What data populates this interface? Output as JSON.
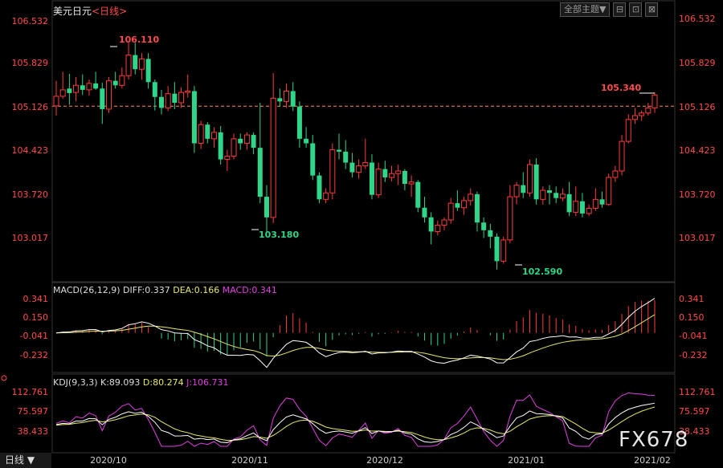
{
  "header": {
    "title": "美元日元",
    "interval": "<日线>",
    "theme_button": "全部主题▼",
    "btn_minimize": "⊟",
    "btn_restore": "⊡",
    "btn_close": "⊠"
  },
  "price_axis": {
    "ticks": [
      "106.532",
      "105.829",
      "105.126",
      "104.423",
      "103.720",
      "103.017"
    ],
    "ref_line": 105.126
  },
  "annotations": {
    "high_label": "106.110",
    "low1_label": "103.180",
    "low2_label": "102.590",
    "last_label": "105.340"
  },
  "macd": {
    "title": "MACD(26,12,9)",
    "diff": "DIFF:0.337",
    "dea": "DEA:0.166",
    "macd": "MACD:0.341",
    "ticks": [
      "0.341",
      "0.150",
      "-0.041",
      "-0.232"
    ]
  },
  "kdj": {
    "title": "KDJ(9,3,3)",
    "k": "K:89.093",
    "d": "D:80.274",
    "j": "J:106.731",
    "ticks": [
      "112.761",
      "75.597",
      "38.433"
    ]
  },
  "x_axis": {
    "labels": [
      "2020/10",
      "2020/11",
      "2020/12",
      "2021/01",
      "2021/02"
    ]
  },
  "footer": {
    "period": "日线",
    "watermark": "FX678"
  },
  "colors": {
    "up": "#ff3b3b",
    "down": "#2fd68a",
    "diff": "#ffffff",
    "dea": "#e8e86a",
    "macd": "#e040e0",
    "ref": "#ff8a5a",
    "axis_text": "#ff4b4b"
  },
  "chart_data": {
    "type": "candlestick",
    "price_range": [
      102.5,
      106.65
    ],
    "candles": [
      {
        "o": 105.13,
        "h": 105.52,
        "l": 104.98,
        "c": 105.28
      },
      {
        "o": 105.28,
        "h": 105.66,
        "l": 105.24,
        "c": 105.38
      },
      {
        "o": 105.4,
        "h": 105.63,
        "l": 105.15,
        "c": 105.33
      },
      {
        "o": 105.34,
        "h": 105.58,
        "l": 105.2,
        "c": 105.45
      },
      {
        "o": 105.45,
        "h": 105.62,
        "l": 105.3,
        "c": 105.38
      },
      {
        "o": 105.38,
        "h": 105.54,
        "l": 105.29,
        "c": 105.48
      },
      {
        "o": 105.48,
        "h": 105.66,
        "l": 105.38,
        "c": 105.4
      },
      {
        "o": 105.4,
        "h": 105.49,
        "l": 104.85,
        "c": 105.08
      },
      {
        "o": 105.08,
        "h": 105.58,
        "l": 105.02,
        "c": 105.52
      },
      {
        "o": 105.52,
        "h": 105.66,
        "l": 105.4,
        "c": 105.45
      },
      {
        "o": 105.45,
        "h": 105.73,
        "l": 105.4,
        "c": 105.6
      },
      {
        "o": 105.6,
        "h": 106.11,
        "l": 105.54,
        "c": 105.92
      },
      {
        "o": 105.92,
        "h": 106.11,
        "l": 105.62,
        "c": 105.7
      },
      {
        "o": 105.7,
        "h": 105.95,
        "l": 105.54,
        "c": 105.86
      },
      {
        "o": 105.86,
        "h": 105.95,
        "l": 105.4,
        "c": 105.5
      },
      {
        "o": 105.5,
        "h": 105.54,
        "l": 105.06,
        "c": 105.27
      },
      {
        "o": 105.27,
        "h": 105.38,
        "l": 105.0,
        "c": 105.1
      },
      {
        "o": 105.1,
        "h": 105.44,
        "l": 105.05,
        "c": 105.32
      },
      {
        "o": 105.32,
        "h": 105.5,
        "l": 105.08,
        "c": 105.18
      },
      {
        "o": 105.18,
        "h": 105.42,
        "l": 105.1,
        "c": 105.34
      },
      {
        "o": 105.34,
        "h": 105.62,
        "l": 105.26,
        "c": 105.36
      },
      {
        "o": 105.36,
        "h": 105.44,
        "l": 104.4,
        "c": 104.55
      },
      {
        "o": 104.55,
        "h": 104.9,
        "l": 104.46,
        "c": 104.84
      },
      {
        "o": 104.84,
        "h": 104.88,
        "l": 104.55,
        "c": 104.62
      },
      {
        "o": 104.62,
        "h": 104.8,
        "l": 104.48,
        "c": 104.72
      },
      {
        "o": 104.72,
        "h": 104.82,
        "l": 104.22,
        "c": 104.3
      },
      {
        "o": 104.3,
        "h": 104.45,
        "l": 104.12,
        "c": 104.35
      },
      {
        "o": 104.35,
        "h": 104.7,
        "l": 104.3,
        "c": 104.62
      },
      {
        "o": 104.62,
        "h": 104.7,
        "l": 104.45,
        "c": 104.55
      },
      {
        "o": 104.55,
        "h": 104.72,
        "l": 104.45,
        "c": 104.68
      },
      {
        "o": 104.68,
        "h": 104.72,
        "l": 104.38,
        "c": 104.48
      },
      {
        "o": 104.48,
        "h": 105.18,
        "l": 103.62,
        "c": 103.72
      },
      {
        "o": 103.72,
        "h": 103.9,
        "l": 103.18,
        "c": 103.4
      },
      {
        "o": 103.4,
        "h": 105.64,
        "l": 103.31,
        "c": 105.25
      },
      {
        "o": 105.25,
        "h": 105.4,
        "l": 105.12,
        "c": 105.2
      },
      {
        "o": 105.2,
        "h": 105.48,
        "l": 105.1,
        "c": 105.36
      },
      {
        "o": 105.36,
        "h": 105.5,
        "l": 105.05,
        "c": 105.12
      },
      {
        "o": 105.12,
        "h": 105.2,
        "l": 104.48,
        "c": 104.62
      },
      {
        "o": 104.62,
        "h": 104.8,
        "l": 104.48,
        "c": 104.55
      },
      {
        "o": 104.55,
        "h": 104.68,
        "l": 103.98,
        "c": 104.05
      },
      {
        "o": 104.05,
        "h": 104.1,
        "l": 103.62,
        "c": 103.68
      },
      {
        "o": 103.68,
        "h": 103.85,
        "l": 103.62,
        "c": 103.78
      },
      {
        "o": 103.78,
        "h": 104.55,
        "l": 103.68,
        "c": 104.45
      },
      {
        "o": 104.45,
        "h": 104.7,
        "l": 104.3,
        "c": 104.42
      },
      {
        "o": 104.42,
        "h": 104.6,
        "l": 104.15,
        "c": 104.25
      },
      {
        "o": 104.25,
        "h": 104.4,
        "l": 104.02,
        "c": 104.1
      },
      {
        "o": 104.1,
        "h": 104.3,
        "l": 104.0,
        "c": 104.2
      },
      {
        "o": 104.2,
        "h": 104.62,
        "l": 104.15,
        "c": 104.25
      },
      {
        "o": 104.25,
        "h": 104.38,
        "l": 103.68,
        "c": 103.75
      },
      {
        "o": 103.75,
        "h": 104.25,
        "l": 103.7,
        "c": 104.15
      },
      {
        "o": 104.15,
        "h": 104.28,
        "l": 103.95,
        "c": 104.02
      },
      {
        "o": 104.02,
        "h": 104.2,
        "l": 103.96,
        "c": 104.08
      },
      {
        "o": 104.08,
        "h": 104.22,
        "l": 103.9,
        "c": 104.12
      },
      {
        "o": 104.12,
        "h": 104.15,
        "l": 103.82,
        "c": 103.92
      },
      {
        "o": 103.92,
        "h": 104.05,
        "l": 103.72,
        "c": 103.95
      },
      {
        "o": 103.95,
        "h": 103.98,
        "l": 103.48,
        "c": 103.55
      },
      {
        "o": 103.55,
        "h": 103.72,
        "l": 103.32,
        "c": 103.4
      },
      {
        "o": 103.4,
        "h": 103.48,
        "l": 102.98,
        "c": 103.18
      },
      {
        "o": 103.18,
        "h": 103.35,
        "l": 103.12,
        "c": 103.28
      },
      {
        "o": 103.28,
        "h": 103.4,
        "l": 103.2,
        "c": 103.36
      },
      {
        "o": 103.36,
        "h": 103.7,
        "l": 103.3,
        "c": 103.62
      },
      {
        "o": 103.62,
        "h": 103.82,
        "l": 103.5,
        "c": 103.55
      },
      {
        "o": 103.55,
        "h": 103.72,
        "l": 103.44,
        "c": 103.66
      },
      {
        "o": 103.66,
        "h": 103.85,
        "l": 103.58,
        "c": 103.76
      },
      {
        "o": 103.76,
        "h": 103.8,
        "l": 103.18,
        "c": 103.32
      },
      {
        "o": 103.32,
        "h": 103.4,
        "l": 103.08,
        "c": 103.2
      },
      {
        "o": 103.2,
        "h": 103.3,
        "l": 102.92,
        "c": 103.1
      },
      {
        "o": 103.1,
        "h": 103.15,
        "l": 102.59,
        "c": 102.72
      },
      {
        "o": 102.72,
        "h": 103.1,
        "l": 102.68,
        "c": 103.05
      },
      {
        "o": 103.05,
        "h": 103.9,
        "l": 103.0,
        "c": 103.72
      },
      {
        "o": 103.72,
        "h": 103.95,
        "l": 103.6,
        "c": 103.9
      },
      {
        "o": 103.9,
        "h": 104.1,
        "l": 103.7,
        "c": 103.78
      },
      {
        "o": 103.78,
        "h": 104.3,
        "l": 103.72,
        "c": 104.22
      },
      {
        "o": 104.22,
        "h": 104.32,
        "l": 103.6,
        "c": 103.68
      },
      {
        "o": 103.68,
        "h": 103.88,
        "l": 103.6,
        "c": 103.82
      },
      {
        "o": 103.82,
        "h": 103.9,
        "l": 103.6,
        "c": 103.78
      },
      {
        "o": 103.78,
        "h": 103.88,
        "l": 103.62,
        "c": 103.7
      },
      {
        "o": 103.7,
        "h": 103.85,
        "l": 103.65,
        "c": 103.76
      },
      {
        "o": 103.76,
        "h": 103.95,
        "l": 103.42,
        "c": 103.48
      },
      {
        "o": 103.48,
        "h": 103.88,
        "l": 103.42,
        "c": 103.65
      },
      {
        "o": 103.65,
        "h": 103.78,
        "l": 103.4,
        "c": 103.46
      },
      {
        "o": 103.46,
        "h": 103.6,
        "l": 103.42,
        "c": 103.54
      },
      {
        "o": 103.54,
        "h": 103.85,
        "l": 103.5,
        "c": 103.68
      },
      {
        "o": 103.68,
        "h": 103.8,
        "l": 103.55,
        "c": 103.6
      },
      {
        "o": 103.6,
        "h": 104.08,
        "l": 103.58,
        "c": 104.02
      },
      {
        "o": 104.02,
        "h": 104.2,
        "l": 103.95,
        "c": 104.12
      },
      {
        "o": 104.12,
        "h": 104.68,
        "l": 104.05,
        "c": 104.58
      },
      {
        "o": 104.58,
        "h": 105.0,
        "l": 104.55,
        "c": 104.92
      },
      {
        "o": 104.92,
        "h": 105.1,
        "l": 104.85,
        "c": 104.98
      },
      {
        "o": 104.98,
        "h": 105.06,
        "l": 104.9,
        "c": 105.02
      },
      {
        "o": 105.02,
        "h": 105.18,
        "l": 104.98,
        "c": 105.1
      },
      {
        "o": 105.1,
        "h": 105.34,
        "l": 105.02,
        "c": 105.3
      }
    ]
  }
}
